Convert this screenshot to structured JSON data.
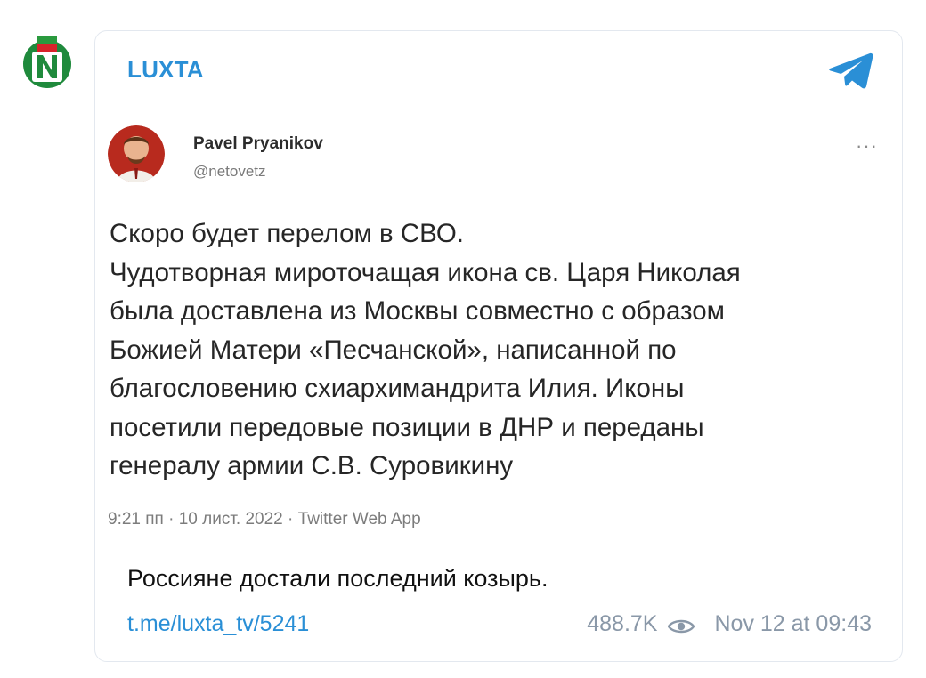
{
  "channel": {
    "name": "LUXTA",
    "avatar_letter": "N"
  },
  "tweet": {
    "author_name": "Pavel Pryanikov",
    "author_handle": "@netovetz",
    "more_label": "···",
    "text_lines": [
      "Скоро будет перелом в СВО.",
      "Чудотворная мироточащая икона св. Царя Николая",
      "была доставлена из Москвы совместно с образом",
      "Божией Матери «Песчанской», написанной по",
      "благословению схиархимандрита Илия. Иконы",
      "посетили передовые позиции в ДНР и переданы",
      "генералу армии С.В. Суровикину"
    ],
    "meta": "9:21 пп · 10 лист. 2022 · Twitter Web App"
  },
  "post": {
    "caption": "Россияне достали последний козырь.",
    "link": "t.me/luxta_tv/5241",
    "views": "488.7K",
    "date": "Nov 12 at 09:43"
  },
  "colors": {
    "accent": "#2a8fd6",
    "border": "#e3e8ef",
    "footer_text": "#8a98a8"
  },
  "icons": {
    "channel": "telegram-icon",
    "views": "eye-icon",
    "tweet_menu": "more-icon"
  }
}
